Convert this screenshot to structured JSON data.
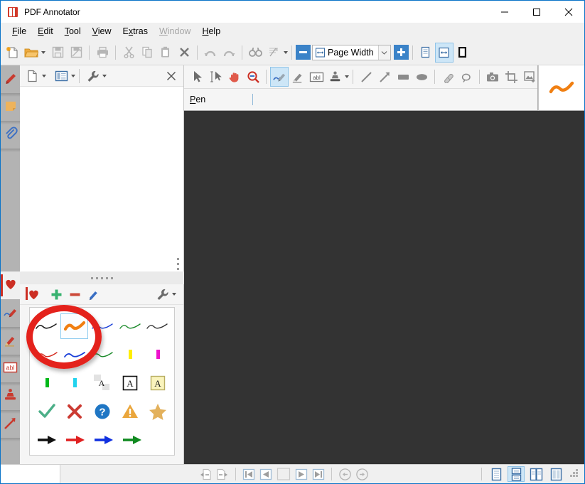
{
  "window": {
    "title": "PDF Annotator",
    "app_icon": "pdf-annotator-logo",
    "minimize": "—",
    "maximize": "□",
    "close": "✕"
  },
  "menubar": {
    "items": [
      {
        "label": "File",
        "accel": "F",
        "disabled": false
      },
      {
        "label": "Edit",
        "accel": "E",
        "disabled": false
      },
      {
        "label": "Tool",
        "accel": "T",
        "disabled": false
      },
      {
        "label": "View",
        "accel": "V",
        "disabled": false
      },
      {
        "label": "Extras",
        "accel": "x",
        "disabled": false
      },
      {
        "label": "Window",
        "accel": "W",
        "disabled": true
      },
      {
        "label": "Help",
        "accel": "H",
        "disabled": false
      }
    ]
  },
  "main_toolbar": {
    "buttons": [
      {
        "name": "new-document-icon",
        "title": "New",
        "enabled": true
      },
      {
        "name": "open-folder-icon",
        "title": "Open",
        "enabled": true,
        "has_dropdown": true
      },
      {
        "name": "save-icon",
        "title": "Save",
        "enabled": false
      },
      {
        "name": "save-as-icon",
        "title": "Save As",
        "enabled": false
      },
      {
        "name": "print-icon",
        "title": "Print",
        "enabled": false
      },
      {
        "name": "cut-icon",
        "title": "Cut",
        "enabled": false
      },
      {
        "name": "copy-icon",
        "title": "Copy",
        "enabled": false
      },
      {
        "name": "paste-icon",
        "title": "Paste",
        "enabled": false
      },
      {
        "name": "delete-icon",
        "title": "Delete",
        "enabled": false
      },
      {
        "name": "undo-icon",
        "title": "Undo",
        "enabled": false
      },
      {
        "name": "redo-icon",
        "title": "Redo",
        "enabled": false
      },
      {
        "name": "find-icon",
        "title": "Find",
        "enabled": false
      },
      {
        "name": "ocr-icon",
        "title": "Recognize Text",
        "enabled": false,
        "has_dropdown": true
      }
    ],
    "zoom": {
      "minus_label": "−",
      "plus_label": "+",
      "value": "Page Width",
      "icon": "page-width-icon",
      "dropdown_icon": "chevron-down-icon"
    },
    "view_modes": [
      {
        "name": "single-page-view-icon",
        "active": false
      },
      {
        "name": "page-width-view-icon",
        "active": true
      },
      {
        "name": "page-border-icon",
        "active": false
      }
    ],
    "accent_blue": "#3b83c8",
    "toggle_bg": "#cde6f7"
  },
  "rail": {
    "tabs": [
      {
        "name": "sidebar-tab-bookmarks",
        "icon": "bookmark-icon",
        "selected": false
      },
      {
        "name": "sidebar-tab-notes",
        "icon": "sticky-note-icon",
        "selected": false
      },
      {
        "name": "sidebar-tab-attachments",
        "icon": "paperclip-icon",
        "selected": false
      },
      {
        "name": "sidebar-tab-favorites",
        "icon": "heart-icon",
        "selected": true
      },
      {
        "name": "sidebar-tab-pen",
        "icon": "pen-icon",
        "selected": false
      },
      {
        "name": "sidebar-tab-marker",
        "icon": "marker-icon",
        "selected": false
      },
      {
        "name": "sidebar-tab-textbox",
        "icon": "abl-textbox-icon",
        "selected": false
      },
      {
        "name": "sidebar-tab-stamp",
        "icon": "stamp-icon",
        "selected": false
      },
      {
        "name": "sidebar-tab-arrow",
        "icon": "arrow-icon",
        "selected": false
      }
    ]
  },
  "left_panel": {
    "toolbar": [
      {
        "name": "page-thumbnail-icon",
        "has_dropdown": true
      },
      {
        "name": "pages-view-icon",
        "has_dropdown": true,
        "active": true
      },
      {
        "name": "wrench-icon",
        "has_dropdown": true
      }
    ],
    "close_label": "✕"
  },
  "favorites_panel": {
    "toolbar": [
      {
        "name": "favorites-heart-icon",
        "label": ""
      },
      {
        "name": "add-favorite-icon",
        "label": "+"
      },
      {
        "name": "remove-favorite-icon",
        "label": "−"
      },
      {
        "name": "edit-favorite-icon",
        "label": ""
      },
      {
        "name": "favorites-wrench-icon",
        "label": "",
        "has_dropdown": true
      }
    ],
    "rows": [
      [
        {
          "name": "favorite-pen-black",
          "type": "squiggle",
          "color": "#222222",
          "selected": false
        },
        {
          "name": "favorite-pen-orange",
          "type": "squiggle",
          "color": "#f07f12",
          "selected": true
        },
        {
          "name": "favorite-pen-blue",
          "type": "squiggle",
          "color": "#1a3fd8",
          "selected": false
        },
        {
          "name": "favorite-pen-green",
          "type": "squiggle",
          "color": "#1b8a2a",
          "selected": false
        },
        {
          "name": "favorite-pen-black2",
          "type": "squiggle",
          "color": "#333333",
          "selected": false
        }
      ],
      [
        {
          "name": "favorite-pen-red",
          "type": "squiggle",
          "color": "#d42a1e",
          "selected": false
        },
        {
          "name": "favorite-pen-blue2",
          "type": "squiggle",
          "color": "#1a3fd8",
          "selected": false
        },
        {
          "name": "favorite-pen-green2",
          "type": "squiggle",
          "color": "#1b8a2a",
          "selected": false
        },
        {
          "name": "favorite-marker-yellow",
          "type": "marker",
          "color": "#ffee00",
          "selected": false
        },
        {
          "name": "favorite-marker-magenta",
          "type": "marker",
          "color": "#ee11cc",
          "selected": false
        }
      ],
      [
        {
          "name": "favorite-marker-green",
          "type": "marker",
          "color": "#00b81a",
          "selected": false
        },
        {
          "name": "favorite-marker-cyan",
          "type": "marker",
          "color": "#22d3ee",
          "selected": false
        },
        {
          "name": "favorite-text-plain",
          "type": "text-plain",
          "label": "A",
          "selected": false
        },
        {
          "name": "favorite-text-boxed",
          "type": "text-boxed",
          "label": "A",
          "selected": false
        },
        {
          "name": "favorite-text-highlight",
          "type": "text-note",
          "label": "A",
          "selected": false
        }
      ],
      [
        {
          "name": "favorite-stamp-check",
          "type": "check",
          "color": "#4caf88",
          "selected": false
        },
        {
          "name": "favorite-stamp-cross",
          "type": "cross",
          "color": "#cc3b33",
          "selected": false
        },
        {
          "name": "favorite-stamp-question",
          "type": "question",
          "color": "#1f76c4",
          "selected": false
        },
        {
          "name": "favorite-stamp-warning",
          "type": "warning",
          "color": "#eaa63c",
          "selected": false
        },
        {
          "name": "favorite-stamp-star",
          "type": "star",
          "color": "#e3b15c",
          "selected": false
        }
      ],
      [
        {
          "name": "favorite-arrow-black",
          "type": "arrow",
          "color": "#111111",
          "selected": false
        },
        {
          "name": "favorite-arrow-red",
          "type": "arrow",
          "color": "#e02020",
          "selected": false
        },
        {
          "name": "favorite-arrow-blue",
          "type": "arrow",
          "color": "#1030e0",
          "selected": false
        },
        {
          "name": "favorite-arrow-green",
          "type": "arrow",
          "color": "#108a20",
          "selected": false
        }
      ]
    ],
    "annotation_highlight": {
      "shape": "circle",
      "color": "#e4221c"
    }
  },
  "annotation_toolbar": {
    "tools": [
      {
        "name": "select-arrow-tool",
        "active": false
      },
      {
        "name": "text-select-tool",
        "active": false
      },
      {
        "name": "hand-pan-tool",
        "active": false
      },
      {
        "name": "zoom-tool",
        "active": false
      },
      {
        "name": "pen-tool",
        "active": true
      },
      {
        "name": "marker-tool",
        "active": false
      },
      {
        "name": "textbox-tool",
        "active": false
      },
      {
        "name": "stamp-tool",
        "active": false,
        "has_dropdown": true
      },
      {
        "name": "line-tool",
        "active": false
      },
      {
        "name": "arrow-tool",
        "active": false
      },
      {
        "name": "rectangle-tool",
        "active": false
      },
      {
        "name": "ellipse-tool",
        "active": false
      },
      {
        "name": "eraser-tool",
        "active": false
      },
      {
        "name": "lasso-tool",
        "active": false
      },
      {
        "name": "snapshot-tool",
        "active": false
      },
      {
        "name": "crop-tool",
        "active": false
      },
      {
        "name": "insert-image-tool",
        "active": false,
        "has_dropdown": true
      },
      {
        "name": "favorites-tool",
        "active": false,
        "has_dropdown": true,
        "color": "#d8281e"
      }
    ],
    "active_tool_label": "Pen",
    "active_tool_accel": "P",
    "preview": {
      "name": "pen-stroke-preview",
      "color": "#f07f12"
    }
  },
  "statusbar": {
    "nav": [
      {
        "name": "previous-view-button",
        "icon": "back-page-icon",
        "enabled": false
      },
      {
        "name": "next-view-button",
        "icon": "fwd-page-icon",
        "enabled": false
      },
      {
        "name": "first-page-button",
        "icon": "first-page-icon",
        "enabled": false
      },
      {
        "name": "prev-page-button",
        "icon": "prev-page-icon",
        "enabled": false
      },
      {
        "name": "page-number-field",
        "icon": "page-field",
        "value": ""
      },
      {
        "name": "next-page-button",
        "icon": "next-page-icon",
        "enabled": false
      },
      {
        "name": "last-page-button",
        "icon": "last-page-icon",
        "enabled": false
      },
      {
        "name": "go-back-button",
        "icon": "circle-back-icon",
        "enabled": false
      },
      {
        "name": "go-forward-button",
        "icon": "circle-fwd-icon",
        "enabled": false
      }
    ],
    "layout_modes": [
      {
        "name": "layout-single-page",
        "active": false
      },
      {
        "name": "layout-continuous",
        "active": true
      },
      {
        "name": "layout-facing",
        "active": false
      },
      {
        "name": "layout-facing-continuous",
        "active": false
      }
    ],
    "resize_grip": "resize-grip-icon"
  },
  "colors": {
    "window_border": "#0a74c8",
    "chrome_bg": "#f0f0f0",
    "document_bg": "#333333",
    "rail_bg": "#b3b3b3",
    "accent": "#3b83c8",
    "selection": "#cde6f7"
  }
}
